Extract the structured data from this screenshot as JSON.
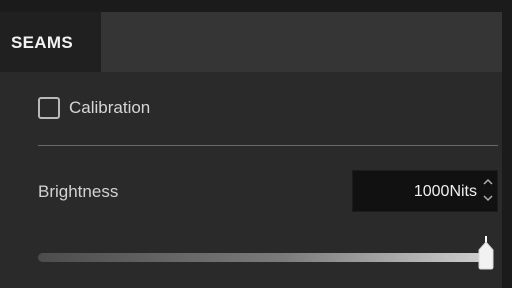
{
  "tabs": [
    {
      "label": "SEAMS",
      "active": true
    }
  ],
  "calibration": {
    "label": "Calibration",
    "checked": false
  },
  "brightness": {
    "label": "Brightness",
    "value": "1000Nits",
    "slider_level": 1.0
  },
  "icons": {
    "spin_up": "chevron-up-icon",
    "spin_down": "chevron-down-icon"
  },
  "colors": {
    "background": "#2a2a2a",
    "tab_active": "#202020",
    "tab_bar": "#353535",
    "spinbox_bg": "#111111"
  }
}
